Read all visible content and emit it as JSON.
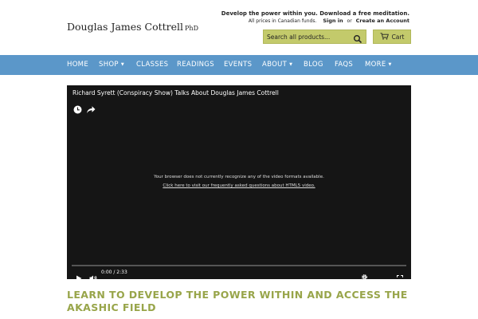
{
  "header": {
    "logo_name": "Douglas James Cottrell",
    "logo_suffix": "PhD",
    "promo": "Develop the power within you. Download a free meditation.",
    "currency_note": "All prices in Canadian funds.",
    "sign_in": "Sign in",
    "or_text": "or",
    "create_account": "Create an Account",
    "search_placeholder": "Search all products...",
    "cart_label": "Cart"
  },
  "nav": {
    "items": [
      {
        "label": "HOME"
      },
      {
        "label": "SHOP"
      },
      {
        "label": "CLASSES"
      },
      {
        "label": "READINGS"
      },
      {
        "label": "EVENTS"
      },
      {
        "label": "ABOUT"
      },
      {
        "label": "BLOG"
      },
      {
        "label": "FAQS"
      },
      {
        "label": "MORE"
      }
    ],
    "dropdown_caret": "▼"
  },
  "video": {
    "title": "Richard Syrett (Conspiracy Show) Talks About Douglas James Cottrell",
    "error_message": "Your browser does not currently recognize any of the video formats available.",
    "error_link": "Click here to visit our frequently asked questions about HTML5 video.",
    "timecode": "0:00 / 2:33"
  },
  "main": {
    "headline": "LEARN TO DEVELOP THE POWER WITHIN AND ACCESS THE AKASHIC FIELD"
  },
  "colors": {
    "nav_bar": "#5b97c9",
    "accent_green": "#98a54a",
    "button_bg": "#c3ca6b",
    "video_bg": "#151515"
  }
}
